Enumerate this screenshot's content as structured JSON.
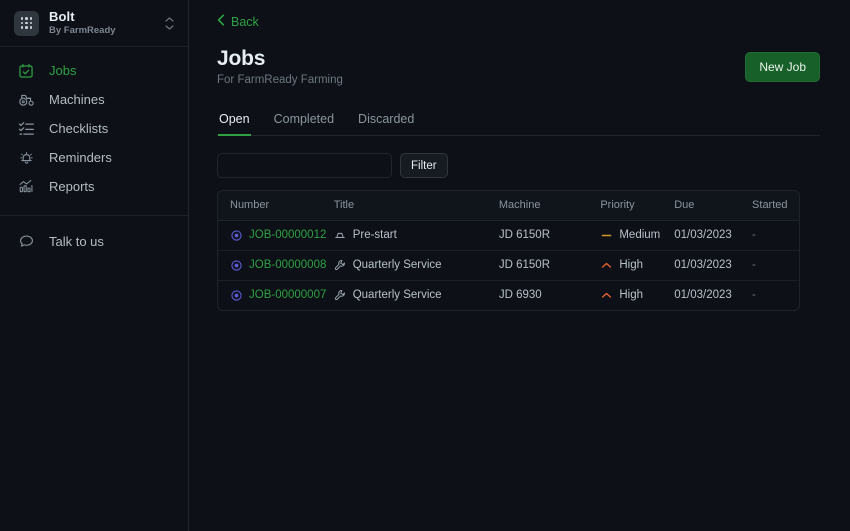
{
  "brand": {
    "name": "Bolt",
    "subtitle": "By FarmReady",
    "logo_icon": "grid-dots-icon",
    "switcher_icon": "chevron-up-down-icon"
  },
  "sidebar": {
    "items": [
      {
        "label": "Jobs",
        "icon": "calendar-check-icon",
        "active": true
      },
      {
        "label": "Machines",
        "icon": "tractor-icon",
        "active": false
      },
      {
        "label": "Checklists",
        "icon": "checklist-icon",
        "active": false
      },
      {
        "label": "Reminders",
        "icon": "bell-icon",
        "active": false
      },
      {
        "label": "Reports",
        "icon": "bar-chart-icon",
        "active": false
      }
    ],
    "bottom_items": [
      {
        "label": "Talk to us",
        "icon": "speech-bubble-icon"
      }
    ]
  },
  "header": {
    "back_label": "Back",
    "back_icon": "chevron-left-icon",
    "title": "Jobs",
    "subtitle": "For FarmReady Farming",
    "new_job_label": "New Job"
  },
  "tabs": [
    {
      "label": "Open",
      "active": true
    },
    {
      "label": "Completed",
      "active": false
    },
    {
      "label": "Discarded",
      "active": false
    }
  ],
  "filter": {
    "value": "",
    "placeholder": "",
    "button_label": "Filter"
  },
  "table": {
    "columns": [
      "Number",
      "Title",
      "Machine",
      "Priority",
      "Due",
      "Started"
    ],
    "rows": [
      {
        "number": "JOB-00000012",
        "number_icon": "target-circle-icon",
        "title": "Pre-start",
        "title_icon": "clipboard-icon",
        "machine": "JD 6150R",
        "priority": "Medium",
        "priority_icon": "minus-icon",
        "due": "01/03/2023",
        "started": "-"
      },
      {
        "number": "JOB-00000008",
        "number_icon": "target-circle-icon",
        "title": "Quarterly Service",
        "title_icon": "wrench-icon",
        "machine": "JD 6150R",
        "priority": "High",
        "priority_icon": "chevron-up-icon",
        "due": "01/03/2023",
        "started": "-"
      },
      {
        "number": "JOB-00000007",
        "number_icon": "target-circle-icon",
        "title": "Quarterly Service",
        "title_icon": "wrench-icon",
        "machine": "JD 6930",
        "priority": "High",
        "priority_icon": "chevron-up-icon",
        "due": "01/03/2023",
        "started": "-"
      }
    ]
  },
  "colors": {
    "background": "#0d1117",
    "accent_green": "#2ea043",
    "link_green": "#2ea043",
    "priority_medium": "#d29922",
    "priority_high": "#e0622e",
    "target_icon": "#5b5bd6",
    "border": "#21262d"
  }
}
